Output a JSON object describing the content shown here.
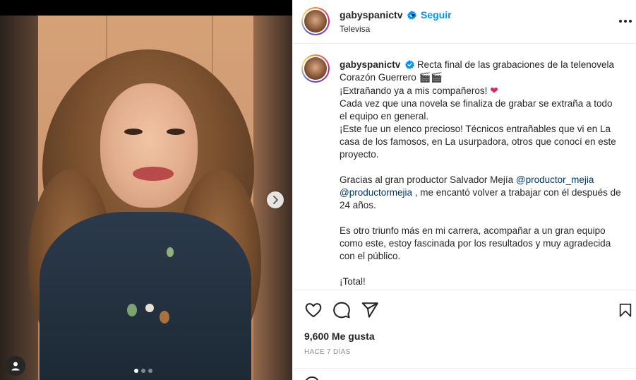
{
  "post": {
    "username": "gabyspanictv",
    "follow_label": "Seguir",
    "separator": "•",
    "location": "Televisa",
    "caption_lines": [
      "Recta final de las grabaciones de la telenovela Corazón Guerrero 🎬🎬",
      "¡Extrañando ya a mis compañeros!",
      " Cada vez que una novela se finaliza de grabar se extraña a todo el equipo en general.",
      "¡Este fue un elenco precioso! Técnicos entrañables que vi en La casa de los famosos, en La usurpadora, otros que conocí en este proyecto."
    ],
    "caption_thanks_prefix": "Gracias al gran productor Salvador Mejía ",
    "mention_1": "@productor_mejia",
    "mention_2": "@productormejia",
    "caption_thanks_suffix": " , me encantó volver a trabajar con él después de 24 años.",
    "caption_closing": "Es otro triunfo más en mi carrera, acompañar a un gran equipo como este, estoy fascinada por los resultados y muy agradecida con el público.",
    "caption_end": "¡Total!",
    "likes": "9,600 Me gusta",
    "time_ago": "HACE 7 DÍAS"
  },
  "carousel": {
    "total_slides": 3,
    "active_slide": 1
  },
  "icons": {
    "verified": "verified-badge-icon",
    "more": "more-options-icon",
    "like": "heart-icon",
    "comment": "comment-icon",
    "share": "share-icon",
    "save": "bookmark-icon",
    "next": "chevron-right-icon",
    "user_tags": "user-icon"
  },
  "colors": {
    "link": "#0095f6",
    "mention": "#00376b",
    "heart": "#e0245e",
    "muted": "#8e8e8e"
  }
}
